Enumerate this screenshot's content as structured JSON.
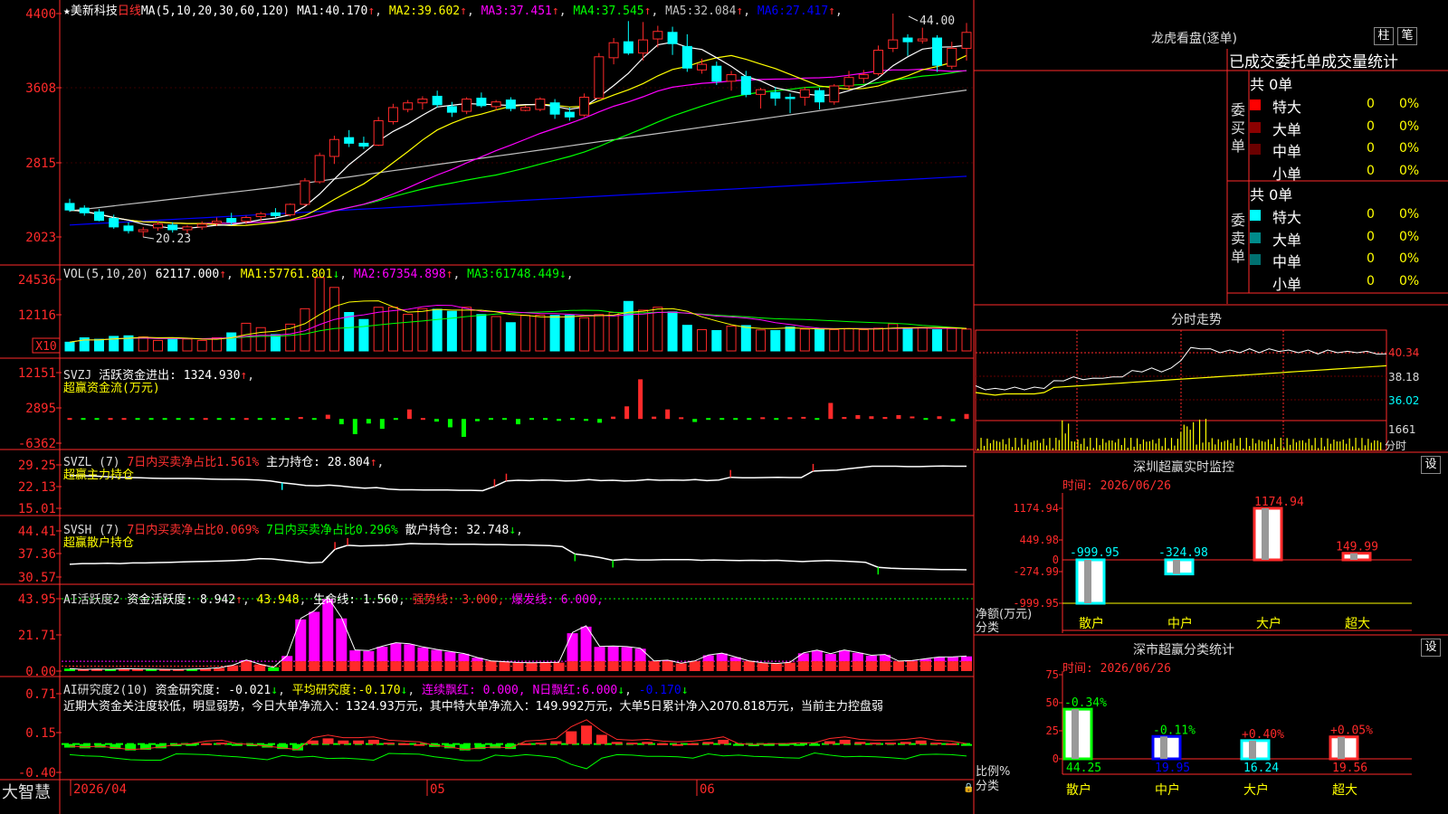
{
  "stock": {
    "star": "★",
    "name": "美新科技",
    "period": "日线",
    "ma_spec": "MA(5,10,20,30,60,120)",
    "ma": [
      {
        "label": "MA1:",
        "value": "40.170",
        "arrow": "↑",
        "color": "#ffffff"
      },
      {
        "label": "MA2:",
        "value": "39.602",
        "arrow": "↑",
        "color": "#ffff00"
      },
      {
        "label": "MA3:",
        "value": "37.451",
        "arrow": "↑",
        "color": "#ff00ff"
      },
      {
        "label": "MA4:",
        "value": "37.545",
        "arrow": "↑",
        "color": "#00ff00"
      },
      {
        "label": "MA5:",
        "value": "32.084",
        "arrow": "↑",
        "color": "#c0c0c0"
      },
      {
        "label": "MA6:",
        "value": "27.417",
        "arrow": "↑",
        "color": "#0000ff"
      }
    ],
    "price_axis": [
      "4400",
      "3608",
      "2815",
      "2023"
    ],
    "max_label": "44.00",
    "min_label": "20.23"
  },
  "vol": {
    "spec": "VOL(5,10,20)",
    "value": "62117.000",
    "arrow": "↑",
    "ma": [
      {
        "label": "MA1:",
        "value": "57761.801",
        "arrow": "↓",
        "color": "#ffff00"
      },
      {
        "label": "MA2:",
        "value": "67354.898",
        "arrow": "↑",
        "color": "#ff00ff"
      },
      {
        "label": "MA3:",
        "value": "61748.449",
        "arrow": "↓",
        "color": "#00ff00"
      }
    ],
    "axis": [
      "24536",
      "12116"
    ],
    "unit": "X10"
  },
  "svzj": {
    "title": "SVZJ",
    "label": "活跃资金进出:",
    "value": "1324.930",
    "arrow": "↑",
    "sub": "超赢资金流(万元)",
    "axis": [
      "12151",
      "2895",
      "-6362"
    ]
  },
  "svzl": {
    "title": "SVZL (7)",
    "text1": "7日内买卖净占比1.561%",
    "label2": "主力持仓:",
    "value2": "28.804",
    "arrow": "↑",
    "sub": "超赢主力持仓",
    "axis": [
      "29.25",
      "22.13",
      "15.01"
    ]
  },
  "svsh": {
    "title": "SVSH (7)",
    "text1": "7日内买卖净占比0.069%",
    "text2": "7日内买卖净占比0.296%",
    "label3": "散户持仓:",
    "value3": "32.748",
    "arrow": "↓",
    "sub": "超赢散户持仓",
    "axis": [
      "44.41",
      "37.36",
      "30.57"
    ]
  },
  "ai1": {
    "title": "AI活跃度2",
    "label": "资金活跃度:",
    "value": "8.942",
    "arrow": "↑",
    "value2": "43.948",
    "label3": "生命线:",
    "value3": "1.560",
    "strong": "强势线: 3.000,",
    "burst": "爆发线: 6.000,",
    "axis": [
      "43.95",
      "21.71",
      "0.00"
    ]
  },
  "ai2": {
    "title": "AI研究度2(10)",
    "label": "资金研究度:",
    "value": "-0.021",
    "arrow": "↓",
    "label2": "平均研究度:",
    "value2": "-0.170",
    "label3": "连续飘红:",
    "value3": "0.000,",
    "label4": "N日飘红:",
    "value4": "6.000",
    "value5": "-0.170",
    "note": "近期大资金关注度较低，明显弱势，今日大单净流入：1324.93万元，其中特大单净流入：149.992万元，大单5日累计净入2070.818万元，当前主力控盘弱",
    "axis": [
      "0.71",
      "0.15",
      "-0.40"
    ]
  },
  "timeline": {
    "brand": "大智慧",
    "dates": [
      "2026/04",
      "05",
      "06"
    ]
  },
  "panel": {
    "title": "龙虎看盘(逐单)",
    "btn_zhu": "柱",
    "btn_bi": "笔",
    "tabs": "已成交委托单成交量统计",
    "buy": {
      "label": "委买单",
      "total": "共 0单",
      "rows": [
        {
          "name": "特大",
          "count": "0",
          "pct": "0%",
          "color": "#ff0000"
        },
        {
          "name": "大单",
          "count": "0",
          "pct": "0%",
          "color": "#8b0000"
        },
        {
          "name": "中单",
          "count": "0",
          "pct": "0%",
          "color": "#6b0000"
        },
        {
          "name": "小单",
          "count": "0",
          "pct": "0%",
          "color": ""
        }
      ]
    },
    "sell": {
      "label": "委卖单",
      "total": "共 0单",
      "rows": [
        {
          "name": "特大",
          "count": "0",
          "pct": "0%",
          "color": "#00ffff"
        },
        {
          "name": "大单",
          "count": "0",
          "pct": "0%",
          "color": "#008b8b"
        },
        {
          "name": "中单",
          "count": "0",
          "pct": "0%",
          "color": "#007070"
        },
        {
          "name": "小单",
          "count": "0",
          "pct": "0%",
          "color": ""
        }
      ]
    }
  },
  "intraday": {
    "title": "分时走势",
    "axis": [
      "40.34",
      "38.18",
      "36.02"
    ],
    "vol_label": "1661",
    "time_label": "分时"
  },
  "monitor": {
    "title": "深圳超赢实时监控",
    "btn": "设",
    "time": "时间: 2026/06/26",
    "axis": [
      "1174.94",
      "449.98",
      "-274.99",
      "-999.95"
    ],
    "zero": "0",
    "ylabel": "净额(万元)",
    "xlabel": "分类"
  },
  "classify": {
    "title": "深市超赢分类统计",
    "btn": "设",
    "time": "时间: 2026/06/26",
    "axis": [
      "75",
      "50",
      "25",
      "0"
    ],
    "ylabel": "比例%",
    "xlabel": "分类"
  },
  "chart_data": [
    {
      "type": "candlestick",
      "title": "美新科技 日线",
      "columns": [
        "open",
        "high",
        "low",
        "close"
      ],
      "x": [
        "2026/04",
        "05",
        "06"
      ],
      "ohlc": [
        [
          23.8,
          24.3,
          22.9,
          23.1
        ],
        [
          23.3,
          23.6,
          22.5,
          22.8
        ],
        [
          22.9,
          23.2,
          21.9,
          22.0
        ],
        [
          22.2,
          22.6,
          21.1,
          21.3
        ],
        [
          21.4,
          21.8,
          20.6,
          20.9
        ],
        [
          20.8,
          21.3,
          20.23,
          21.0
        ],
        [
          21.2,
          21.9,
          20.9,
          21.6
        ],
        [
          21.5,
          21.8,
          20.7,
          21.0
        ],
        [
          21.0,
          21.5,
          20.6,
          21.3
        ],
        [
          21.3,
          21.9,
          21.0,
          21.6
        ],
        [
          21.7,
          22.3,
          21.4,
          21.9
        ],
        [
          22.2,
          22.8,
          21.5,
          21.8
        ],
        [
          21.9,
          22.5,
          21.6,
          22.3
        ],
        [
          22.4,
          22.9,
          21.9,
          22.7
        ],
        [
          22.8,
          23.3,
          22.3,
          22.5
        ],
        [
          22.6,
          23.8,
          22.4,
          23.7
        ],
        [
          23.7,
          26.5,
          23.5,
          26.2
        ],
        [
          26.1,
          29.2,
          25.9,
          28.9
        ],
        [
          28.8,
          31.0,
          28.0,
          30.6
        ],
        [
          30.8,
          31.6,
          29.8,
          30.2
        ],
        [
          30.2,
          30.9,
          29.6,
          29.9
        ],
        [
          30.0,
          33.0,
          29.9,
          32.6
        ],
        [
          32.5,
          34.4,
          32.2,
          34.0
        ],
        [
          33.8,
          34.8,
          33.5,
          34.5
        ],
        [
          34.5,
          35.2,
          33.8,
          34.9
        ],
        [
          35.2,
          35.8,
          34.0,
          34.3
        ],
        [
          34.1,
          34.6,
          33.0,
          33.5
        ],
        [
          33.6,
          35.1,
          33.3,
          34.9
        ],
        [
          35.0,
          35.6,
          34.0,
          34.2
        ],
        [
          34.1,
          34.8,
          33.7,
          34.6
        ],
        [
          34.8,
          35.1,
          33.6,
          33.9
        ],
        [
          33.7,
          34.2,
          33.6,
          34.0
        ],
        [
          33.8,
          35.1,
          33.6,
          34.9
        ],
        [
          34.5,
          34.9,
          32.8,
          33.3
        ],
        [
          33.5,
          34.0,
          32.6,
          33.0
        ],
        [
          33.2,
          35.5,
          33.0,
          35.1
        ],
        [
          35.0,
          39.8,
          34.9,
          39.4
        ],
        [
          39.3,
          41.4,
          38.6,
          40.9
        ],
        [
          41.0,
          43.2,
          39.6,
          39.8
        ],
        [
          39.8,
          43.1,
          39.0,
          41.2
        ],
        [
          41.3,
          42.7,
          40.4,
          42.1
        ],
        [
          42.0,
          42.6,
          39.6,
          40.8
        ],
        [
          40.5,
          41.8,
          37.8,
          38.2
        ],
        [
          38.0,
          39.2,
          37.6,
          38.6
        ],
        [
          38.4,
          38.9,
          36.4,
          36.8
        ],
        [
          36.8,
          37.9,
          35.8,
          37.5
        ],
        [
          37.3,
          37.9,
          35.1,
          35.4
        ],
        [
          35.4,
          36.1,
          33.9,
          35.9
        ],
        [
          35.6,
          36.2,
          34.2,
          35.0
        ],
        [
          35.1,
          35.5,
          33.4,
          35.0
        ],
        [
          35.1,
          36.2,
          34.2,
          35.9
        ],
        [
          35.8,
          36.1,
          33.8,
          34.6
        ],
        [
          34.6,
          36.5,
          34.3,
          36.3
        ],
        [
          36.3,
          37.9,
          35.9,
          37.2
        ],
        [
          37.1,
          38.0,
          36.6,
          37.5
        ],
        [
          37.6,
          40.6,
          37.4,
          40.1
        ],
        [
          40.3,
          44.0,
          39.9,
          41.2
        ],
        [
          41.4,
          41.8,
          39.5,
          41.0
        ],
        [
          41.1,
          42.5,
          40.8,
          41.3
        ],
        [
          41.4,
          41.7,
          37.8,
          38.5
        ],
        [
          38.4,
          41.0,
          38.1,
          40.3
        ],
        [
          40.3,
          43.0,
          39.0,
          42.0
        ]
      ]
    },
    {
      "type": "bar",
      "title": "VOL(5,10,20)",
      "ylim": [
        0,
        24536
      ],
      "values": [
        3000,
        4500,
        4000,
        5000,
        5200,
        4800,
        3600,
        4200,
        4100,
        3600,
        4500,
        6200,
        9500,
        8000,
        5600,
        9200,
        14500,
        25200,
        21800,
        13200,
        10800,
        15000,
        15000,
        12600,
        14500,
        14300,
        13600,
        15000,
        12500,
        11800,
        9700,
        12200,
        12300,
        12200,
        12200,
        11400,
        12500,
        13200,
        17000,
        14000,
        15000,
        13400,
        8800,
        7300,
        7000,
        8500,
        8700,
        7200,
        7000,
        8200,
        7500,
        7700,
        7300,
        7600,
        7300,
        7800,
        9300,
        7800,
        8000,
        7300,
        7700,
        7500
      ]
    },
    {
      "type": "bar",
      "title": "SVZJ 活跃资金进出",
      "ylim": [
        -6362,
        12151
      ],
      "values": [
        0,
        -400,
        -300,
        0,
        0,
        -200,
        -200,
        -100,
        -100,
        -200,
        0,
        -200,
        -100,
        0,
        -200,
        -100,
        -100,
        500,
        -300,
        1100,
        -1400,
        -4000,
        -1200,
        -2600,
        -300,
        2500,
        0,
        -700,
        -2200,
        -4700,
        -600,
        -400,
        -300,
        -1400,
        -300,
        -200,
        -500,
        -400,
        -500,
        -1000,
        600,
        3300,
        10400,
        600,
        2500,
        200,
        -800,
        -300,
        -300,
        -200,
        -100,
        200,
        -100,
        200,
        300,
        -300,
        4200,
        500,
        1000,
        700,
        500,
        1000,
        400,
        -300,
        700,
        -600,
        1300
      ]
    },
    {
      "type": "line",
      "title": "SVZL 主力持仓",
      "ylim": [
        15.01,
        29.25
      ],
      "values": [
        25.8,
        25.7,
        25.6,
        25.4,
        25.2,
        25.1,
        25.0,
        24.9,
        24.8,
        24.8,
        24.8,
        24.7,
        24.6,
        24.5,
        24.5,
        24.4,
        24.3,
        24.0,
        23.4,
        23.0,
        22.5,
        22.4,
        22.6,
        22.3,
        21.9,
        21.6,
        21.8,
        21.3,
        21.1,
        21.1,
        21.0,
        21.0,
        21.0,
        20.9,
        20.9,
        20.8,
        22.2,
        24.0,
        24.2,
        24.1,
        24.3,
        24.2,
        24.0,
        24.1,
        24.4,
        24.1,
        24.2,
        24.0,
        24.1,
        24.4,
        24.2,
        24.3,
        24.2,
        24.4,
        24.1,
        24.3,
        25.2,
        25.0,
        25.0,
        25.1,
        25.2,
        25.1,
        25.1,
        27.2,
        27.4,
        27.5,
        28.0,
        28.4,
        28.8,
        28.8,
        28.8,
        28.7,
        28.7,
        28.8,
        28.9,
        28.8,
        28.804
      ]
    },
    {
      "type": "line",
      "title": "SVSH 散户持仓",
      "ylim": [
        30.57,
        44.41
      ],
      "values": [
        34.4,
        34.6,
        34.6,
        34.7,
        34.6,
        34.8,
        34.8,
        34.9,
        35.0,
        35.1,
        35.2,
        35.3,
        35.4,
        35.5,
        35.7,
        36.1,
        36.0,
        35.6,
        35.2,
        34.8,
        35.0,
        38.9,
        40.1,
        39.9,
        40.0,
        40.1,
        40.3,
        40.6,
        40.5,
        40.5,
        40.4,
        40.4,
        40.4,
        40.3,
        40.3,
        40.2,
        40.2,
        40.1,
        40.0,
        39.7,
        37.5,
        37.0,
        36.4,
        35.6,
        35.9,
        35.7,
        35.7,
        35.8,
        35.8,
        35.8,
        35.6,
        35.7,
        35.6,
        35.5,
        35.6,
        35.5,
        35.6,
        35.4,
        35.2,
        35.4,
        35.5,
        35.4,
        35.2,
        35.0,
        33.5,
        33.2,
        33.1,
        33.0,
        32.9,
        32.8,
        32.8,
        32.748
      ]
    },
    {
      "type": "bar",
      "title": "AI活跃度2 资金活跃度",
      "ylim": [
        0,
        43.95
      ],
      "values": [
        1.5,
        1.0,
        1.2,
        1.1,
        1.4,
        1.3,
        1.2,
        1.1,
        1.0,
        1.2,
        1.5,
        2.0,
        3.5,
        6.6,
        4.1,
        2.3,
        9.2,
        31.4,
        36.0,
        43.948,
        32.0,
        12.6,
        12.2,
        14.8,
        16.9,
        16.3,
        14.4,
        12.9,
        11.7,
        10.5,
        8.1,
        6.1,
        5.6,
        5.1,
        5.0,
        5.1,
        5.2,
        23.0,
        27.0,
        14.7,
        14.9,
        14.6,
        13.6,
        6.1,
        6.5,
        4.7,
        6.1,
        9.6,
        10.7,
        8.4,
        6.1,
        5.0,
        4.5,
        5.2,
        10.8,
        12.5,
        10.4,
        12.6,
        11.1,
        9.4,
        9.9,
        6.0,
        6.3,
        7.4,
        8.4,
        8.5,
        8.942
      ]
    },
    {
      "type": "bar",
      "title": "AI研究度2(10) 资金研究度",
      "ylim": [
        -0.4,
        0.71
      ],
      "values": [
        -0.05,
        -0.06,
        -0.05,
        -0.07,
        -0.09,
        -0.08,
        -0.06,
        -0.03,
        -0.02,
        0.01,
        0.02,
        -0.02,
        -0.03,
        -0.05,
        -0.07,
        -0.09,
        0.05,
        0.08,
        0.05,
        0.05,
        0.06,
        0.02,
        0.01,
        0.0,
        -0.04,
        -0.06,
        -0.09,
        -0.07,
        -0.06,
        -0.07,
        0.01,
        0.02,
        0.04,
        0.18,
        0.26,
        0.13,
        0.03,
        0.02,
        0.03,
        0.01,
        0.0,
        0.01,
        0.03,
        0.06,
        -0.02,
        -0.03,
        -0.02,
        -0.02,
        -0.01,
        -0.01,
        0.04,
        0.06,
        0.03,
        0.02,
        0.02,
        0.03,
        0.05,
        0.02,
        0.01,
        -0.021
      ]
    },
    {
      "type": "line",
      "title": "分时走势",
      "ylim": [
        36.02,
        40.34
      ],
      "values": [
        38.0,
        37.9,
        37.8,
        37.9,
        37.9,
        37.9,
        37.9,
        38.0,
        38.4,
        38.6,
        38.7,
        38.7,
        38.6,
        38.8,
        38.7,
        38.9,
        39.2,
        39.3,
        39.4,
        39.3,
        39.4,
        40.2,
        41.0,
        41.1,
        40.9,
        40.8,
        40.8,
        40.8,
        40.9,
        40.8,
        40.9,
        40.9,
        40.8,
        40.8,
        40.8,
        40.7,
        40.8,
        40.8,
        40.7,
        40.8,
        40.7,
        40.7,
        40.5
      ]
    },
    {
      "type": "bar",
      "title": "深圳超赢实时监控",
      "categories": [
        "散户",
        "中户",
        "大户",
        "超大"
      ],
      "values": [
        -999.95,
        -324.98,
        1174.94,
        149.99
      ],
      "ylim": [
        -999.95,
        1174.94
      ]
    },
    {
      "type": "bar",
      "title": "深市超赢分类统计",
      "categories": [
        "散户",
        "中户",
        "大户",
        "超大"
      ],
      "values": [
        44.25,
        19.95,
        16.24,
        19.56
      ],
      "change": [
        "-0.34%",
        "-0.11%",
        "+0.40%",
        "+0.05%"
      ],
      "ylim": [
        0,
        75
      ]
    }
  ]
}
